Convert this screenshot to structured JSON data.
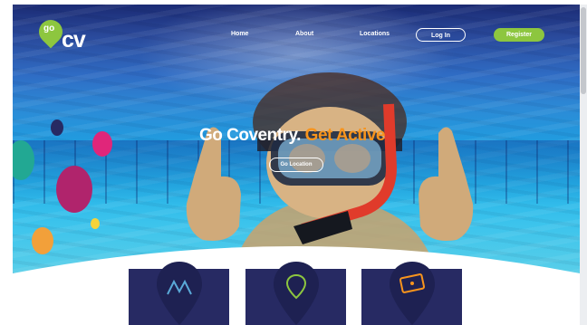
{
  "logo": {
    "go": "go",
    "cv": "cv"
  },
  "nav": {
    "home": "Home",
    "about": "About",
    "locations": "Locations",
    "login": "Log In",
    "register": "Register"
  },
  "hero": {
    "headline_white": "Go Coventry.",
    "headline_orange": "Get Active",
    "cta": "Go Location"
  },
  "features": [
    {
      "icon": "mountain-icon"
    },
    {
      "icon": "location-pin-icon"
    },
    {
      "icon": "ticket-icon"
    }
  ],
  "colors": {
    "brand_green": "#8dc63f",
    "accent_orange": "#f7941d",
    "card_navy": "#272a63"
  }
}
